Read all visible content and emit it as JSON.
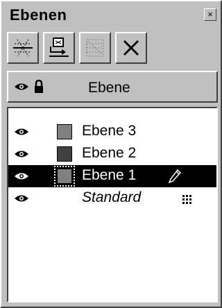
{
  "window": {
    "title": "Ebenen",
    "close_glyph": "×"
  },
  "toolbar": {
    "buttons": [
      {
        "name": "new-layer",
        "icon": "new-layer-icon",
        "enabled": true
      },
      {
        "name": "move-to-layer",
        "icon": "move-to-layer-icon",
        "enabled": true
      },
      {
        "name": "merge-layer",
        "icon": "merge-layer-icon",
        "enabled": false
      },
      {
        "name": "delete-layer",
        "icon": "delete-icon",
        "enabled": true
      }
    ]
  },
  "header": {
    "label": "Ebene",
    "icons": [
      "eye-icon",
      "lock-icon"
    ]
  },
  "layers": [
    {
      "label": "Ebene 3",
      "swatch": "#808080",
      "italic": false,
      "selected": false
    },
    {
      "label": "Ebene 2",
      "swatch": "#404040",
      "italic": false,
      "selected": false
    },
    {
      "label": "Ebene 1",
      "swatch": "#808080",
      "italic": false,
      "selected": true,
      "indicator": "pencil-icon"
    },
    {
      "label": "Standard",
      "italic": true,
      "selected": false,
      "indicator": "grid-dots-icon"
    }
  ]
}
